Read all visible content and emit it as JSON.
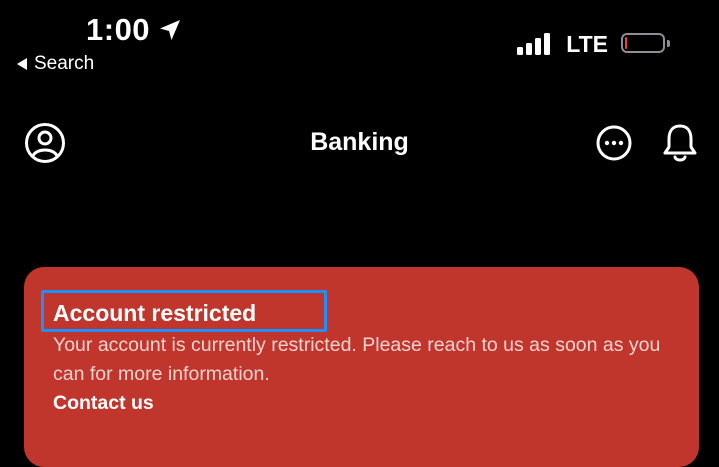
{
  "status_bar": {
    "time": "1:00",
    "back_label": "Search",
    "network": "LTE",
    "battery_level": 0.05,
    "signal_bars": 4,
    "icons": [
      "location-arrow-icon",
      "back-triangle-icon",
      "signal-icon",
      "battery-icon"
    ]
  },
  "nav": {
    "title": "Banking",
    "icons": [
      "profile-icon",
      "more-icon",
      "bell-icon"
    ]
  },
  "alert": {
    "title": "Account restricted",
    "message": "Your account is currently restricted. Please reach to us as soon as you can for more information.",
    "link_label": "Contact us"
  },
  "colors": {
    "background": "#000000",
    "alert_background": "#c0362c",
    "highlight_border": "#1e8fff",
    "battery_low": "#ff3b30"
  }
}
